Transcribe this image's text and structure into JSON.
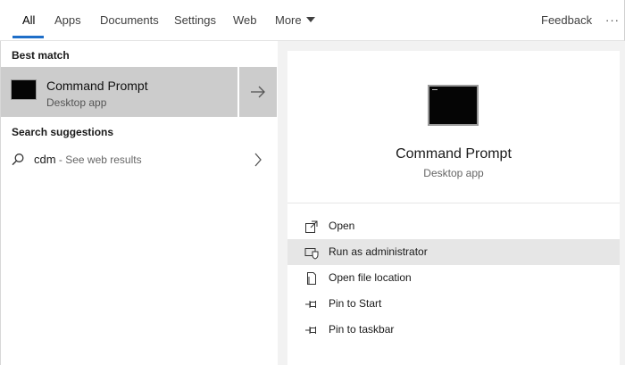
{
  "tabs": [
    {
      "label": "All",
      "active": true
    },
    {
      "label": "Apps"
    },
    {
      "label": "Documents"
    },
    {
      "label": "Settings"
    },
    {
      "label": "Web"
    },
    {
      "label": "More"
    }
  ],
  "header": {
    "feedback_label": "Feedback",
    "overflow_label": "···"
  },
  "best_match": {
    "section_label": "Best match",
    "title": "Command Prompt",
    "subtitle": "Desktop app",
    "icon": "command-prompt-icon"
  },
  "suggestions": {
    "section_label": "Search suggestions",
    "items": [
      {
        "query": "cdm",
        "suffix": " - See web results",
        "icon": "search-icon"
      }
    ]
  },
  "detail": {
    "title": "Command Prompt",
    "subtitle": "Desktop app",
    "actions": [
      {
        "label": "Open",
        "icon": "open-icon"
      },
      {
        "label": "Run as administrator",
        "icon": "shield-icon",
        "highlighted": true
      },
      {
        "label": "Open file location",
        "icon": "file-location-icon"
      },
      {
        "label": "Pin to Start",
        "icon": "pin-icon"
      },
      {
        "label": "Pin to taskbar",
        "icon": "pin-icon"
      }
    ]
  },
  "colors": {
    "accent": "#1e6ec8",
    "selection": "#cccccc",
    "hover": "#e6e6e6"
  }
}
